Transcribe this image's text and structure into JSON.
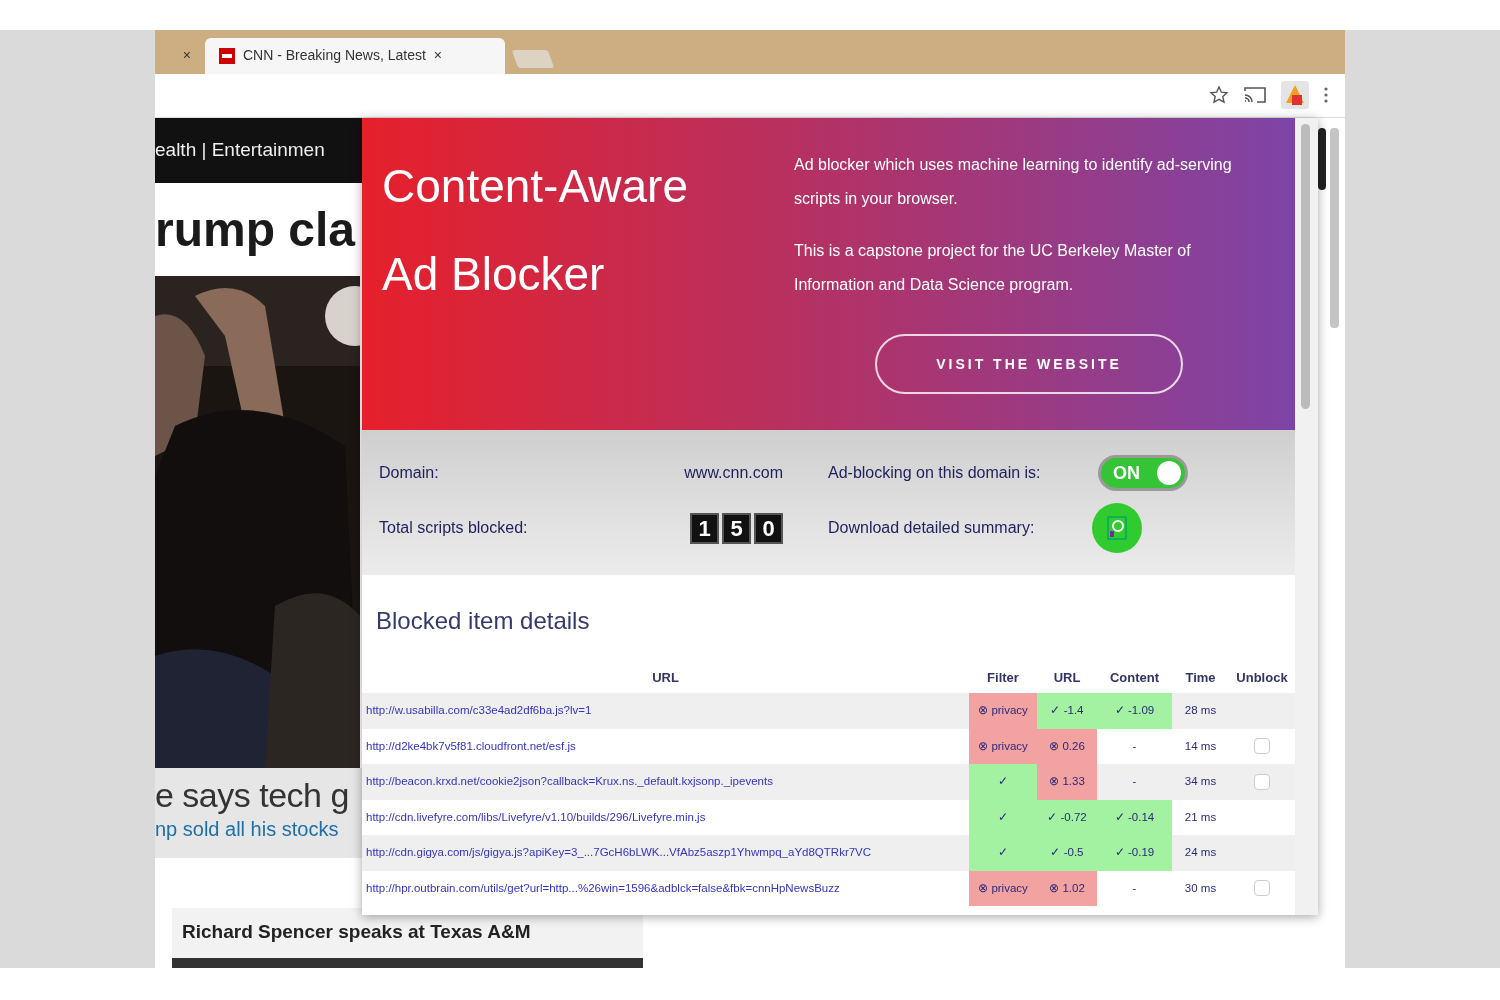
{
  "browser": {
    "tabs": [
      {
        "close": "×",
        "selected": false
      },
      {
        "title": "CNN - Breaking News, Latest",
        "close": "×",
        "selected": true
      }
    ]
  },
  "page": {
    "nav": "ealth | Entertainmen",
    "headline": "rump cla",
    "caption": "e says tech g",
    "sublink": "np sold all his stocks",
    "card_title": "Richard Spencer speaks at Texas A&M"
  },
  "popup": {
    "title": "Content-Aware Ad Blocker",
    "description": [
      "Ad blocker which uses machine learning to identify ad-serving scripts in your browser.",
      "This is a capstone project for the UC Berkeley Master of Information and Data Science program."
    ],
    "website_button": "VISIT THE WEBSITE",
    "domain_label": "Domain:",
    "domain": "www.cnn.com",
    "toggle_label": "Ad-blocking on this domain is:",
    "toggle": {
      "text": "ON",
      "on": true
    },
    "blocked_label": "Total scripts blocked:",
    "blocked_digits": [
      "1",
      "5",
      "0"
    ],
    "download_label": "Download detailed summary:",
    "details_title": "Blocked item details",
    "columns": [
      "URL",
      "Filter",
      "URL",
      "Content",
      "Time",
      "Unblock"
    ],
    "rows": [
      {
        "cells": [
          {
            "text": "http://w.usabilla.com/c33e4ad2df6ba.js?lv=1",
            "kind": "link"
          },
          {
            "text": "⊗ privacy",
            "kind": "blocked"
          },
          {
            "text": "✓ -1.4",
            "kind": "passed"
          },
          {
            "text": "✓ -1.09",
            "kind": "passed"
          },
          {
            "text": "28 ms",
            "kind": "plain"
          }
        ]
      },
      {
        "cells": [
          {
            "text": "http://d2ke4bk7v5f81.cloudfront.net/esf.js",
            "kind": "link"
          },
          {
            "text": "⊗ privacy",
            "kind": "blocked"
          },
          {
            "text": "⊗ 0.26",
            "kind": "blocked"
          },
          {
            "text": "-",
            "kind": "plain"
          },
          {
            "text": "14 ms",
            "kind": "plain"
          },
          {
            "kind": "checkbox",
            "checked": false
          }
        ]
      },
      {
        "cells": [
          {
            "text": "http://beacon.krxd.net/cookie2json?callback=Krux.ns._default.kxjsonp._ipevents",
            "kind": "link"
          },
          {
            "text": "✓",
            "kind": "passed"
          },
          {
            "text": "⊗ 1.33",
            "kind": "blocked"
          },
          {
            "text": "-",
            "kind": "plain"
          },
          {
            "text": "34 ms",
            "kind": "plain"
          },
          {
            "kind": "checkbox",
            "checked": false
          }
        ]
      },
      {
        "cells": [
          {
            "text": "http://cdn.livefyre.com/libs/Livefyre/v1.10/builds/296/Livefyre.min.js",
            "kind": "link"
          },
          {
            "text": "✓",
            "kind": "passed"
          },
          {
            "text": "✓ -0.72",
            "kind": "passed"
          },
          {
            "text": "✓ -0.14",
            "kind": "passed"
          },
          {
            "text": "21 ms",
            "kind": "plain"
          }
        ]
      },
      {
        "cells": [
          {
            "text": "http://cdn.gigya.com/js/gigya.js?apiKey=3_...7GcH6bLWK...VfAbz5aszp1Yhwmpq_aYd8QTRkr7VC",
            "kind": "link"
          },
          {
            "text": "✓",
            "kind": "passed"
          },
          {
            "text": "✓ -0.5",
            "kind": "passed"
          },
          {
            "text": "✓ -0.19",
            "kind": "passed"
          },
          {
            "text": "24 ms",
            "kind": "plain"
          }
        ]
      },
      {
        "cells": [
          {
            "text": "http://hpr.outbrain.com/utils/get?url=http...%26win=1596&adblck=false&fbk=cnnHpNewsBuzz",
            "kind": "link"
          },
          {
            "text": "⊗ privacy",
            "kind": "blocked"
          },
          {
            "text": "⊗ 1.02",
            "kind": "blocked"
          },
          {
            "text": "-",
            "kind": "plain"
          },
          {
            "text": "30 ms",
            "kind": "plain"
          },
          {
            "kind": "checkbox",
            "checked": false
          }
        ]
      }
    ]
  }
}
